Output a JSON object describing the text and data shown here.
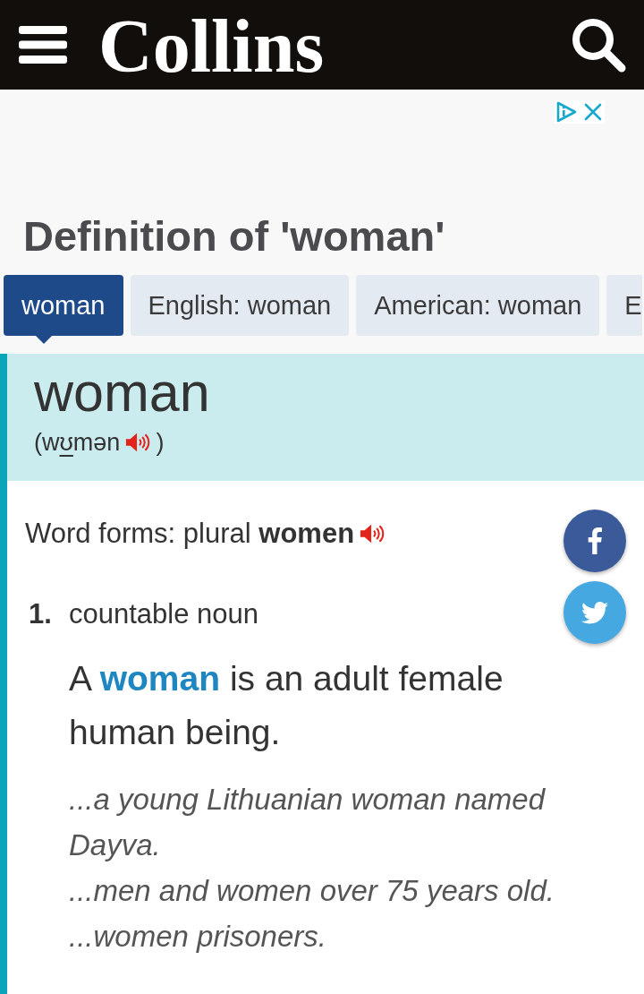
{
  "header": {
    "logo": "Collins"
  },
  "page_title": "Definition of 'woman'",
  "tabs": [
    {
      "label": "woman",
      "selected": true
    },
    {
      "label": "English: woman",
      "selected": false
    },
    {
      "label": "American: woman",
      "selected": false
    },
    {
      "label": "E",
      "selected": false
    }
  ],
  "entry": {
    "headword": "woman",
    "pronunciation": {
      "text_before": "(w",
      "underlined_part": "ʊ",
      "text_after": "mən",
      "close": ")"
    },
    "word_forms": "Word forms: plural **women**",
    "senses": [
      {
        "number": "1.",
        "grammar": "countable noun",
        "definition": [
          {
            "kind": "text",
            "text": "A "
          },
          {
            "kind": "link",
            "text": "woman"
          },
          {
            "kind": "text",
            "text": " is an adult female human being."
          }
        ],
        "examples": [
          "...a young Lithuanian woman named Dayva.",
          "...men and women over 75 years old.",
          "...women prisoners."
        ]
      }
    ]
  }
}
